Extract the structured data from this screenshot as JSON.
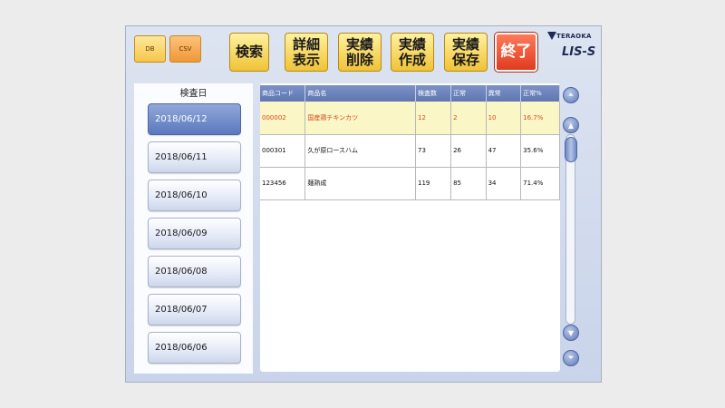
{
  "toolbar": {
    "db_label": "DB",
    "csv_label": "CSV",
    "search_label": "検索",
    "detail_label": "詳細\n表示",
    "delete_label": "実績\n削除",
    "create_label": "実績\n作成",
    "save_label": "実績\n保存",
    "exit_label": "終了"
  },
  "logo": {
    "brand": "TERAOKA",
    "product": "LIS-S"
  },
  "dates": {
    "header": "検査日",
    "items": [
      "2018/06/12",
      "2018/06/11",
      "2018/06/10",
      "2018/06/09",
      "2018/06/08",
      "2018/06/07",
      "2018/06/06"
    ],
    "selected_index": 0
  },
  "table": {
    "columns": [
      "商品コード",
      "商品名",
      "検査数",
      "正常",
      "異常",
      "正常%"
    ],
    "rows": [
      [
        "000002",
        "国産鶏チキンカツ",
        "12",
        "2",
        "10",
        "16.7%"
      ],
      [
        "000301",
        "久が原ロースハム",
        "73",
        "26",
        "47",
        "35.6%"
      ],
      [
        "123456",
        "麺熟成",
        "119",
        "85",
        "34",
        "71.4%"
      ]
    ],
    "selected_row": 0
  },
  "colors": {
    "accent": "#5f76b0",
    "exit": "#e03b1f",
    "button": "#f0c335"
  }
}
